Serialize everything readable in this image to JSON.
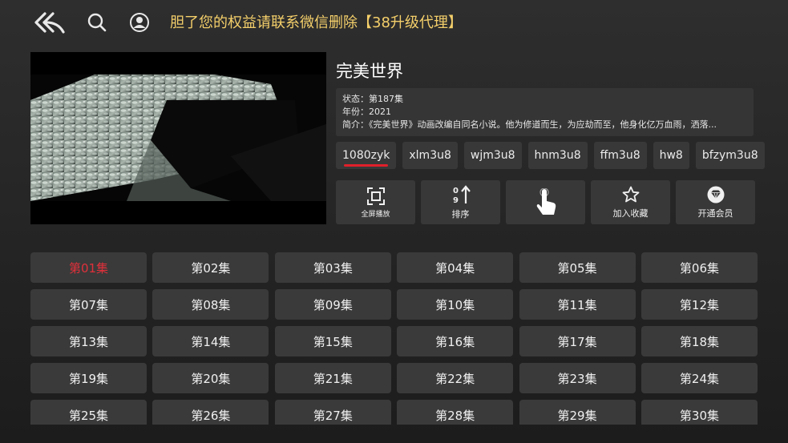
{
  "header": {
    "marquee": "胆了您的权益请联系微信删除【38升级代理】",
    "icons": [
      "back-icon",
      "search-icon",
      "user-icon"
    ]
  },
  "detail": {
    "title": "完美世界",
    "status": "状态：第187集",
    "year": "年份：2021",
    "intro": "简介：《完美世界》动画改编自同名小说。他为修道而生，为应劫而至，他身化亿万血雨，洒落..."
  },
  "sources": [
    {
      "label": "1080zyk",
      "active": true
    },
    {
      "label": "xlm3u8"
    },
    {
      "label": "wjm3u8"
    },
    {
      "label": "hnm3u8"
    },
    {
      "label": "ffm3u8"
    },
    {
      "label": "hw8"
    },
    {
      "label": "bfzym3u8"
    }
  ],
  "actions": [
    {
      "label": "全屏播放",
      "icon": "fullscreen-icon"
    },
    {
      "label": "排序",
      "icon": "sort-icon"
    },
    {
      "label": "",
      "icon": "tap-hand-icon"
    },
    {
      "label": "加入收藏",
      "icon": "star-icon"
    },
    {
      "label": "开通会员",
      "icon": "vip-diamond-icon"
    }
  ],
  "episodes": [
    "第01集",
    "第02集",
    "第03集",
    "第04集",
    "第05集",
    "第06集",
    "第07集",
    "第08集",
    "第09集",
    "第10集",
    "第11集",
    "第12集",
    "第13集",
    "第14集",
    "第15集",
    "第16集",
    "第17集",
    "第18集",
    "第19集",
    "第20集",
    "第21集",
    "第22集",
    "第23集",
    "第24集",
    "第25集",
    "第26集",
    "第27集",
    "第28集",
    "第29集",
    "第30集"
  ],
  "active_episode": 0,
  "colors": {
    "accent": "#e0202a",
    "marquee": "#f4cf6a",
    "tile": "#3a3a3a"
  }
}
